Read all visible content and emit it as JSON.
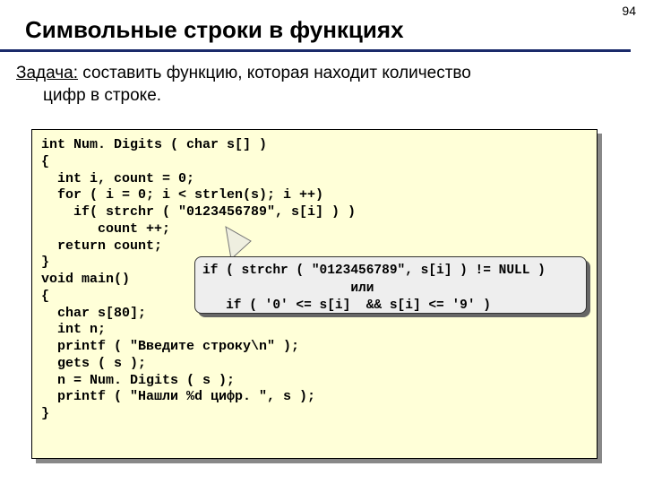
{
  "page_number": "94",
  "title": "Символьные строки в функциях",
  "task": {
    "label": "Задача:",
    "line1": " составить функцию, которая находит количество",
    "line2": "цифр в строке."
  },
  "code": "int Num. Digits ( char s[] )\n{\n  int i, count = 0;\n  for ( i = 0; i < strlen(s); i ++)\n    if( strchr ( \"0123456789\", s[i] ) )\n       count ++;\n  return count;\n}\nvoid main()\n{\n  char s[80];\n  int n;\n  printf ( \"Введите строку\\n\" );\n  gets ( s );\n  n = Num. Digits ( s );\n  printf ( \"Нашли %d цифр. \", s );\n}",
  "callout": {
    "line1": "if ( strchr ( \"0123456789\", s[i] ) != NULL )",
    "line2": "                   или",
    "line3": "   if ( '0' <= s[i]  && s[i] <= '9' )"
  }
}
